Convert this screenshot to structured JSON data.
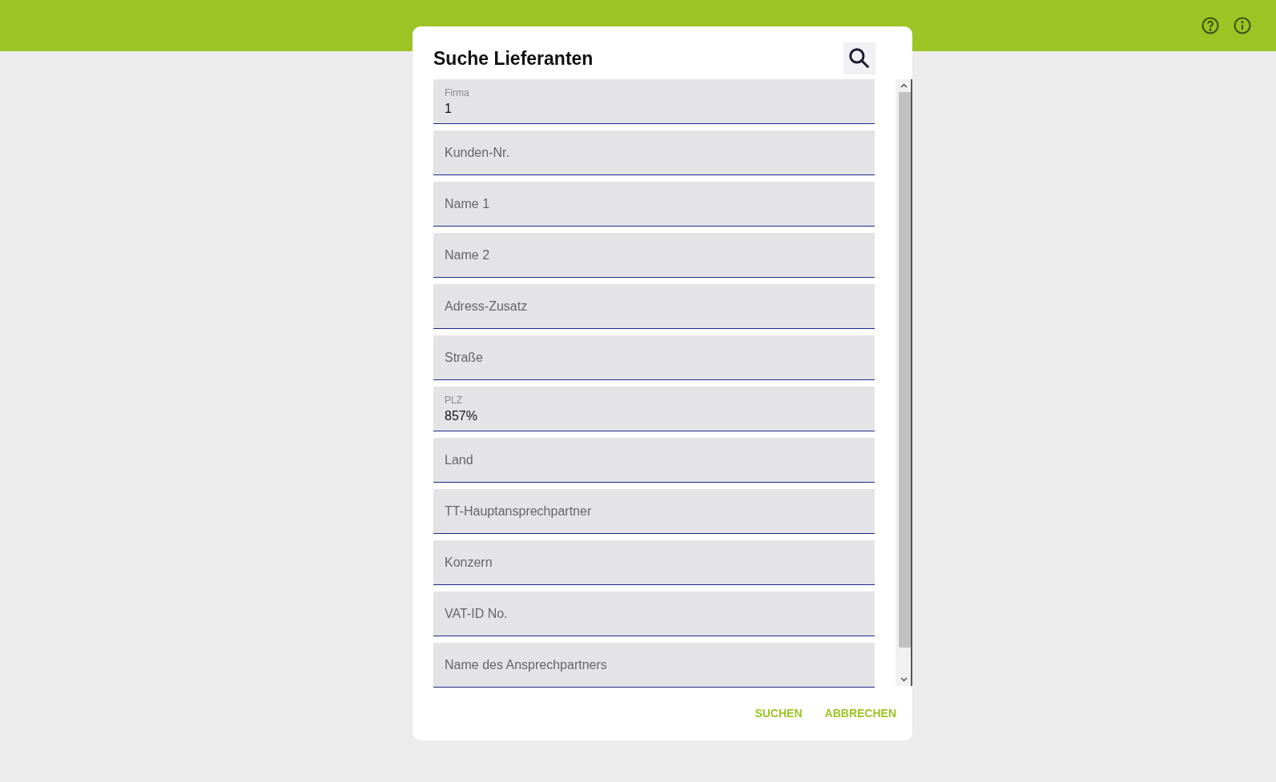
{
  "dialog": {
    "title": "Suche Lieferanten",
    "fields": [
      {
        "label": "Firma",
        "value": "1"
      },
      {
        "placeholder": "Kunden-Nr."
      },
      {
        "placeholder": "Name 1"
      },
      {
        "placeholder": "Name 2"
      },
      {
        "placeholder": "Adress-Zusatz"
      },
      {
        "placeholder": "Straße"
      },
      {
        "label": "PLZ",
        "value": "857%"
      },
      {
        "placeholder": "Land"
      },
      {
        "placeholder": "TT-Hauptansprechpartner"
      },
      {
        "placeholder": "Konzern"
      },
      {
        "placeholder": "VAT-ID No."
      },
      {
        "placeholder": "Name des Ansprechpartners"
      }
    ],
    "buttons": [
      "SUCHEN",
      "ABBRECHEN"
    ]
  }
}
